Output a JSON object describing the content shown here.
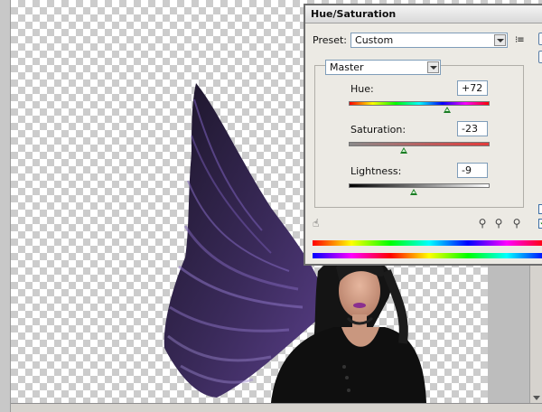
{
  "dialog": {
    "title": "Hue/Saturation",
    "preset_label": "Preset:",
    "preset_value": "Custom",
    "preset_options_icon": "list-options-icon",
    "channel_value": "Master",
    "hue": {
      "label": "Hue:",
      "value": "+72",
      "level": 0.7
    },
    "saturation": {
      "label": "Saturation:",
      "value": "-23",
      "level": 0.39
    },
    "lightness": {
      "label": "Lightness:",
      "value": "-9",
      "level": 0.46
    },
    "colorize_checked": true
  },
  "colors": {
    "accent_thumb": "#1a7d23",
    "wing_purple": "#3d2a5c",
    "dialog_bg": "#eceae4"
  },
  "icons": [
    "hand-adjust-icon",
    "eyedropper-icon",
    "eyedropper-plus-icon",
    "eyedropper-minus-icon",
    "dropdown-arrow-icon"
  ]
}
